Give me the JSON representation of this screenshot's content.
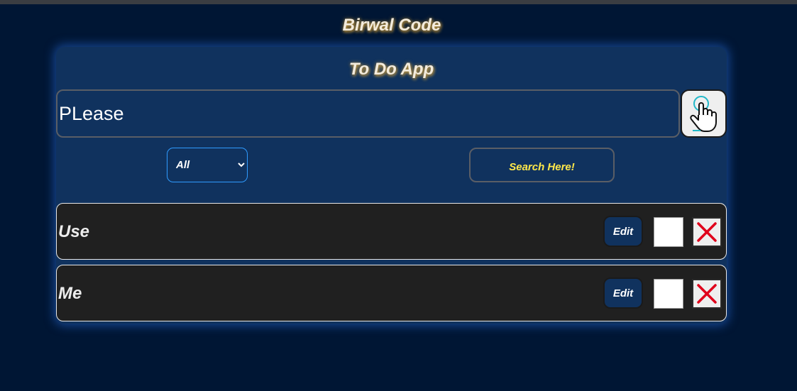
{
  "header": {
    "brand": "Birwal Code"
  },
  "app": {
    "title": "To Do App",
    "task_input": {
      "value": "PLease",
      "placeholder": ""
    },
    "add_button_icon": "pointer-hand-icon",
    "filter": {
      "selected": "All"
    },
    "search_button_label": "Search Here!"
  },
  "tasks": [
    {
      "text": "Use",
      "edit_label": "Edit",
      "completed": false
    },
    {
      "text": "Me",
      "edit_label": "Edit",
      "completed": false
    }
  ],
  "icons": {
    "add": "pointer-hand-icon",
    "delete": "close-x-icon"
  },
  "colors": {
    "page_bg": "#001634",
    "card_bg": "#10325e",
    "task_bg": "#202020",
    "search_text": "#ffe84a",
    "delete_x": "#e0001b",
    "accent_glow": "#286edc"
  }
}
